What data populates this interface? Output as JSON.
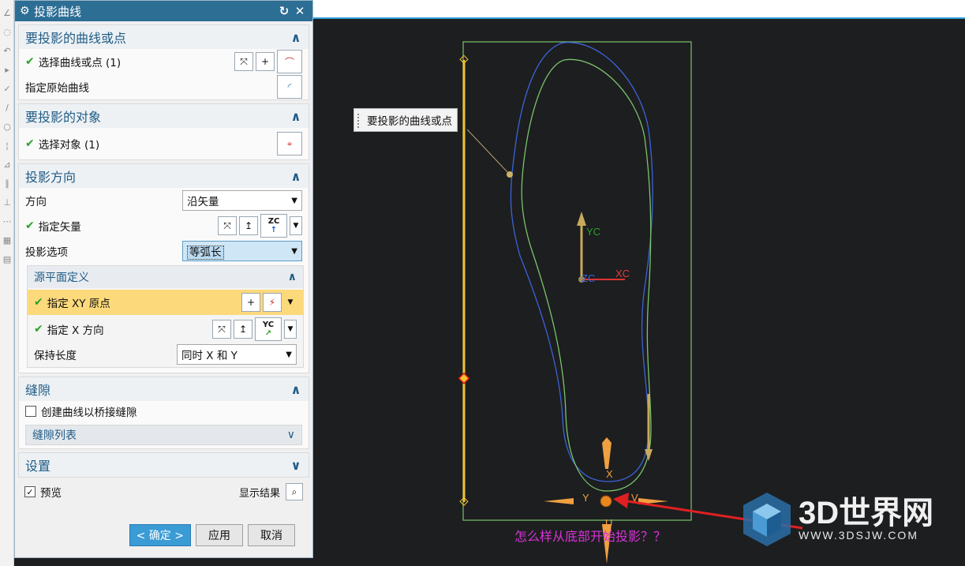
{
  "dialog": {
    "title": "投影曲线",
    "groups": {
      "curves": {
        "title": "要投影的曲线或点",
        "select_label": "选择曲线或点 (1)",
        "original_label": "指定原始曲线"
      },
      "objects": {
        "title": "要投影的对象",
        "select_label": "选择对象 (1)"
      },
      "direction": {
        "title": "投影方向",
        "direction_label": "方向",
        "direction_value": "沿矢量",
        "vector_label": "指定矢量",
        "vector_axis": "ZC",
        "option_label": "投影选项",
        "option_value": "等弧长",
        "source_plane": {
          "title": "源平面定义",
          "xy_origin_label": "指定 XY 原点",
          "x_dir_label": "指定 X 方向",
          "x_dir_axis": "YC",
          "keep_length_label": "保持长度",
          "keep_length_value": "同时 X 和 Y"
        }
      },
      "gap": {
        "title": "缝隙",
        "bridge_label": "创建曲线以桥接缝隙",
        "list_label": "缝隙列表"
      },
      "settings": {
        "title": "设置",
        "preview_label": "预览",
        "show_result_label": "显示结果"
      }
    },
    "footer": {
      "ok": "< 确定 >",
      "apply": "应用",
      "cancel": "取消"
    }
  },
  "viewport": {
    "tooltip": "要投影的曲线或点",
    "question": "怎么样从底部开始投影？？",
    "axes": {
      "yc": "YC",
      "xc": "XC",
      "zc": "ZC",
      "x": "X",
      "y": "Y",
      "u": "U",
      "v": "V"
    },
    "watermark": {
      "title": "3D世界网",
      "url": "WWW.3DSJW.COM"
    }
  },
  "colors": {
    "title_bar": "#2d6e95",
    "accent_text": "#1f5c86",
    "highlight_row": "#fcd97b",
    "viewport_bg": "#1d1e20",
    "curve_blue": "#3b63d9",
    "curve_green": "#79c36a",
    "line_yellow": "#f1c232",
    "question_text": "#d633d6"
  }
}
